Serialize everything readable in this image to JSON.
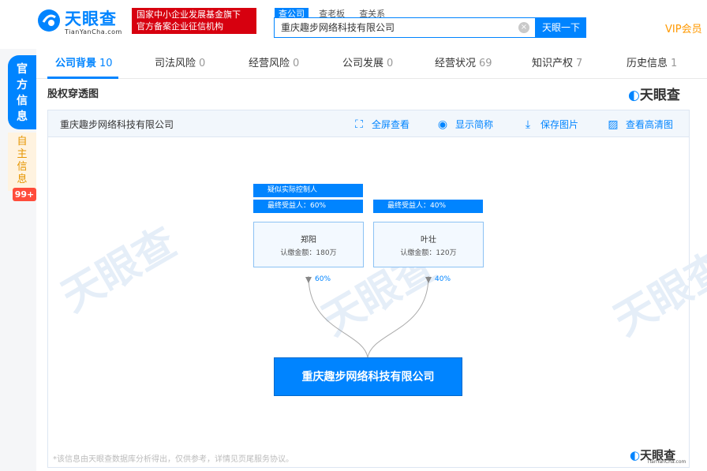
{
  "header": {
    "logo_text": "天眼查",
    "logo_sub": "TianYanCha.com",
    "badge_line1": "国家中小企业发展基金旗下",
    "badge_line2": "官方备案企业征信机构",
    "search_tabs": [
      "查公司",
      "查老板",
      "查关系"
    ],
    "search_value": "重庆趣步网络科技有限公司",
    "search_button": "天眼一下",
    "vip_label": "VIP会员"
  },
  "sidebar": {
    "official_label": "官方信息",
    "self_label": "自主信息",
    "self_badge": "99+"
  },
  "tabs": [
    {
      "label": "公司背景",
      "count": "10"
    },
    {
      "label": "司法风险",
      "count": "0"
    },
    {
      "label": "经营风险",
      "count": "0"
    },
    {
      "label": "公司发展",
      "count": "0"
    },
    {
      "label": "经营状况",
      "count": "69"
    },
    {
      "label": "知识产权",
      "count": "7"
    },
    {
      "label": "历史信息",
      "count": "1"
    }
  ],
  "section": {
    "title": "股权穿透图",
    "brand": "天眼查"
  },
  "panel": {
    "company": "重庆趣步网络科技有限公司",
    "fullscreen": "全屏查看",
    "show_short": "显示简称",
    "save_image": "保存图片",
    "view_hd": "查看高清图"
  },
  "graph": {
    "shareholders": [
      {
        "tag_top": "疑似实际控制人",
        "tag": "最终受益人：60%",
        "name": "郑阳",
        "amount": "认缴金额：180万",
        "pct": "60%"
      },
      {
        "tag": "最终受益人：40%",
        "name": "叶壮",
        "amount": "认缴金额：120万",
        "pct": "40%"
      }
    ],
    "target": "重庆趣步网络科技有限公司"
  },
  "footer": {
    "note": "*该信息由天眼查数据库分析得出，仅供参考，详情见页尾服务协议。",
    "brand": "天眼查",
    "brand_sub": "TianYanCha.com"
  },
  "colors": {
    "accent": "#0084ff",
    "badge_red": "#d7000f",
    "vip": "#ff9900"
  },
  "icons": [
    "tianyancha-logo-icon",
    "clear-icon",
    "fullscreen-icon",
    "eye-icon",
    "download-icon",
    "image-icon",
    "arrow-down-icon"
  ]
}
